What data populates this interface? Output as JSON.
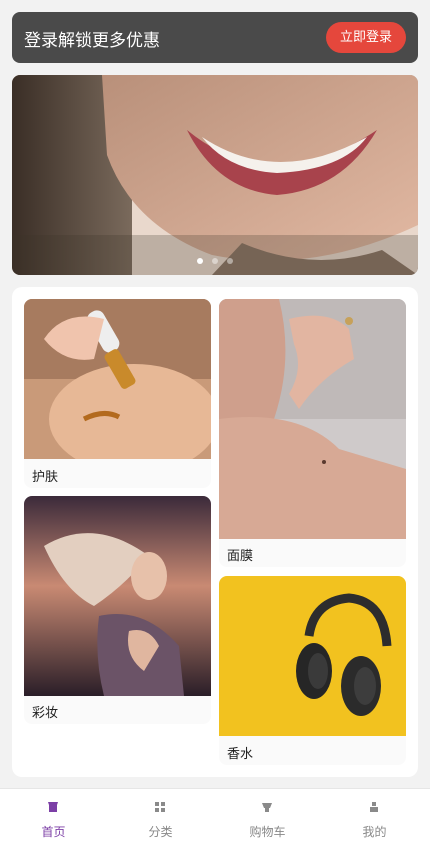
{
  "login_banner": {
    "text": "登录解锁更多优惠",
    "button_label": "立即登录"
  },
  "carousel": {
    "slide_count": 3,
    "active_index": 0
  },
  "categories": [
    {
      "label": "护肤"
    },
    {
      "label": "面膜"
    },
    {
      "label": "彩妆"
    },
    {
      "label": "香水"
    }
  ],
  "nav": {
    "items": [
      {
        "label": "首页",
        "icon": "home-icon",
        "active": true
      },
      {
        "label": "分类",
        "icon": "grid-icon",
        "active": false
      },
      {
        "label": "购物车",
        "icon": "cart-icon",
        "active": false
      },
      {
        "label": "我的",
        "icon": "user-icon",
        "active": false
      }
    ]
  },
  "colors": {
    "accent": "#7c3fa6",
    "login_button": "#e5473c",
    "banner_bg": "#4a4a4a"
  }
}
